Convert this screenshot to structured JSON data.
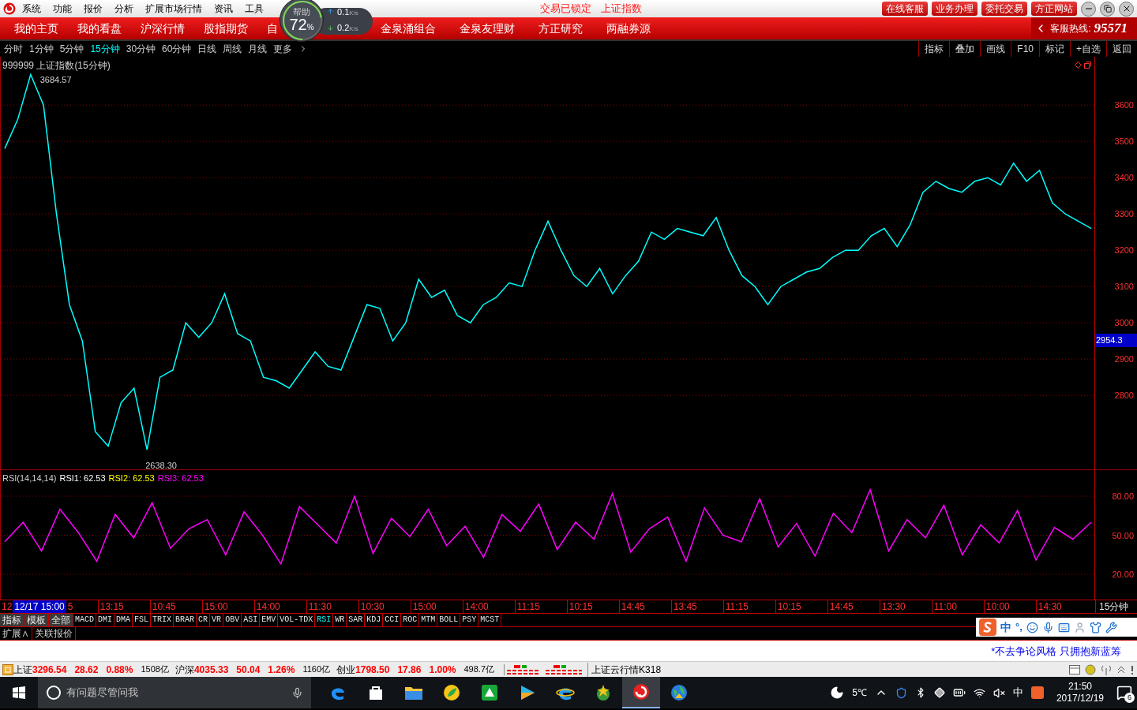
{
  "title_bar": {
    "menu": [
      "系统",
      "功能",
      "报价",
      "分析",
      "扩展市场行情",
      "资讯",
      "工具"
    ],
    "status": [
      "交易已锁定",
      "上证指数"
    ],
    "buttons": [
      "在线客服",
      "业务办理",
      "委托交易",
      "方正网站"
    ]
  },
  "speed_widget": {
    "label": "帮助",
    "percent": "72",
    "unit": "%",
    "upload": "0.1",
    "upload_unit": "K/s",
    "download": "0.2",
    "download_unit": "K/s"
  },
  "nav": {
    "tabs": [
      "我的主页",
      "我的看盘",
      "沪深行情",
      "股指期货",
      "自"
    ],
    "tabs_right": [
      "金泉涌组合",
      "金泉友理财",
      "方正研究",
      "两融券源"
    ],
    "hotline_label": "客服热线:",
    "hotline": "95571"
  },
  "periods": [
    {
      "label": "分时",
      "selected": false
    },
    {
      "label": "1分钟",
      "selected": false
    },
    {
      "label": "5分钟",
      "selected": false
    },
    {
      "label": "15分钟",
      "selected": true
    },
    {
      "label": "30分钟",
      "selected": false
    },
    {
      "label": "60分钟",
      "selected": false
    },
    {
      "label": "日线",
      "selected": false
    },
    {
      "label": "周线",
      "selected": false
    },
    {
      "label": "月线",
      "selected": false
    },
    {
      "label": "更多",
      "selected": false
    }
  ],
  "tools": [
    "指标",
    "叠加",
    "画线",
    "F10",
    "标记",
    "+自选",
    "返回"
  ],
  "main_chart": {
    "title": "999999 上证指数(15分钟)",
    "high_label": "3684.57",
    "low_label": "2638.30",
    "cursor_price": "2954.3",
    "chart_data": {
      "type": "line",
      "grid": true,
      "ylim": [
        2596,
        3733
      ],
      "yticks": [
        2800,
        2900,
        3000,
        3100,
        3200,
        3300,
        3400,
        3500,
        3600
      ],
      "series": [
        {
          "color": "#00ffff",
          "values": [
            3480,
            3560,
            3684,
            3600,
            3300,
            3050,
            2950,
            2700,
            2660,
            2780,
            2820,
            2650,
            2850,
            2870,
            3000,
            2960,
            3000,
            3080,
            2970,
            2950,
            2850,
            2840,
            2820,
            2870,
            2920,
            2880,
            2870,
            2960,
            3050,
            3040,
            2950,
            3000,
            3120,
            3070,
            3090,
            3020,
            3000,
            3050,
            3070,
            3110,
            3100,
            3200,
            3280,
            3200,
            3130,
            3100,
            3150,
            3080,
            3130,
            3170,
            3250,
            3230,
            3260,
            3250,
            3240,
            3290,
            3200,
            3130,
            3100,
            3050,
            3100,
            3120,
            3140,
            3150,
            3180,
            3200,
            3200,
            3240,
            3260,
            3210,
            3270,
            3360,
            3390,
            3370,
            3360,
            3390,
            3400,
            3380,
            3440,
            3390,
            3420,
            3330,
            3300,
            3280,
            3260
          ]
        }
      ]
    }
  },
  "rsi": {
    "title": "RSI(14,14,14)",
    "readings": [
      {
        "label": "RSI1:",
        "value": "62.53",
        "color": "#ffffff"
      },
      {
        "label": "RSI2:",
        "value": "62.53",
        "color": "#ffff00"
      },
      {
        "label": "RSI3:",
        "value": "62.53",
        "color": "#ff00ff"
      }
    ],
    "chart_data": {
      "type": "line",
      "grid": true,
      "ylim": [
        0,
        100
      ],
      "yticks": [
        {
          "value": 20,
          "label": "20.00"
        },
        {
          "value": 50,
          "label": "50.00"
        },
        {
          "value": 80,
          "label": "80.00"
        }
      ],
      "series": [
        {
          "color": "#ff00ff",
          "values": [
            45,
            60,
            38,
            70,
            52,
            30,
            66,
            48,
            75,
            40,
            55,
            62,
            35,
            68,
            50,
            28,
            72,
            58,
            44,
            80,
            36,
            63,
            49,
            70,
            42,
            57,
            33,
            66,
            53,
            74,
            39,
            60,
            47,
            82,
            37,
            55,
            64,
            30,
            71,
            50,
            45,
            78,
            41,
            59,
            34,
            67,
            52,
            85,
            38,
            62,
            48,
            73,
            35,
            58,
            44,
            69,
            31,
            56,
            47,
            60
          ]
        }
      ]
    }
  },
  "time_axis": {
    "lead": "12",
    "cursor": "12/17 15:00",
    "partial": "5",
    "labels": [
      "13:15",
      "10:45",
      "15:00",
      "14:00",
      "11:30",
      "10:30",
      "15:00",
      "14:00",
      "11:15",
      "10:15",
      "14:45",
      "13:45",
      "11:15",
      "10:15",
      "14:45",
      "13:30",
      "11:00",
      "10:00",
      "14:30"
    ],
    "period": "15分钟"
  },
  "indicator_tabs": [
    {
      "label": "指标",
      "kind": "group",
      "selected": false
    },
    {
      "label": "模板",
      "kind": "group",
      "selected": false
    },
    {
      "label": "全部",
      "kind": "group",
      "selected": false
    },
    {
      "label": "MACD",
      "kind": "formula",
      "selected": false
    },
    {
      "label": "DMI",
      "kind": "formula",
      "selected": false
    },
    {
      "label": "DMA",
      "kind": "formula",
      "selected": false
    },
    {
      "label": "FSL",
      "kind": "formula",
      "selected": false
    },
    {
      "label": "TRIX",
      "kind": "formula",
      "selected": false
    },
    {
      "label": "BRAR",
      "kind": "formula",
      "selected": false
    },
    {
      "label": "CR",
      "kind": "formula",
      "selected": false
    },
    {
      "label": "VR",
      "kind": "formula",
      "selected": false
    },
    {
      "label": "OBV",
      "kind": "formula",
      "selected": false
    },
    {
      "label": "ASI",
      "kind": "formula",
      "selected": false
    },
    {
      "label": "EMV",
      "kind": "formula",
      "selected": false
    },
    {
      "label": "VOL-TDX",
      "kind": "formula",
      "selected": false
    },
    {
      "label": "RSI",
      "kind": "formula",
      "selected": true
    },
    {
      "label": "WR",
      "kind": "formula",
      "selected": false
    },
    {
      "label": "SAR",
      "kind": "formula",
      "selected": false
    },
    {
      "label": "KDJ",
      "kind": "formula",
      "selected": false
    },
    {
      "label": "CCI",
      "kind": "formula",
      "selected": false
    },
    {
      "label": "ROC",
      "kind": "formula",
      "selected": false
    },
    {
      "label": "MTM",
      "kind": "formula",
      "selected": false
    },
    {
      "label": "BOLL",
      "kind": "formula",
      "selected": false
    },
    {
      "label": "PSY",
      "kind": "formula",
      "selected": false
    },
    {
      "label": "MCST",
      "kind": "formula",
      "selected": false
    }
  ],
  "extra_tabs": [
    "扩展∧",
    "关联报价"
  ],
  "ime": {
    "mode": "中",
    "punct": "°,"
  },
  "slogan": "*不去争论风格 只拥抱新蓝筹",
  "status_bar": {
    "indices": [
      {
        "name": "上证",
        "value": "3296.54",
        "change": "28.62",
        "pct": "0.88%",
        "amount": "1508亿"
      },
      {
        "name": "沪深",
        "value": "4035.33",
        "change": "50.04",
        "pct": "1.26%",
        "amount": "1160亿"
      },
      {
        "name": "创业",
        "value": "1798.50",
        "change": "17.86",
        "pct": "1.00%",
        "amount": "498.7亿"
      }
    ],
    "ticker": "上证云行情K318"
  },
  "taskbar": {
    "search_placeholder": "有问题尽管问我",
    "apps": [
      {
        "kind": "edge",
        "selected": false
      },
      {
        "kind": "store",
        "selected": false
      },
      {
        "kind": "folder",
        "selected": false
      },
      {
        "kind": "leaf",
        "selected": false
      },
      {
        "kind": "green",
        "selected": false
      },
      {
        "kind": "play",
        "selected": false
      },
      {
        "kind": "ie",
        "selected": false
      },
      {
        "kind": "star",
        "selected": false
      },
      {
        "kind": "swirl",
        "selected": true
      },
      {
        "kind": "globe",
        "selected": false
      }
    ],
    "weather": "5℃",
    "ime": "中",
    "time": "21:50",
    "date": "2017/12/19",
    "notifications": "6"
  }
}
